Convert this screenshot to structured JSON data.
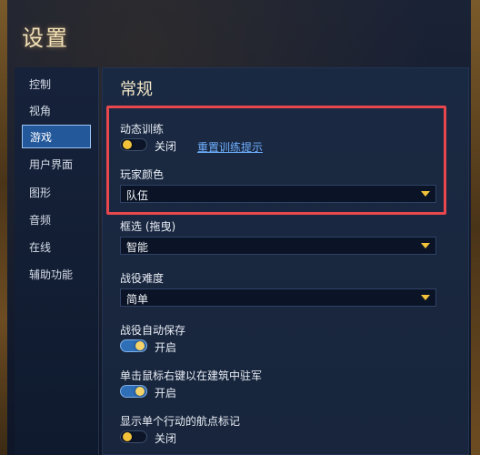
{
  "window": {
    "title": "设置"
  },
  "sidebar": {
    "items": [
      {
        "label": "控制"
      },
      {
        "label": "视角"
      },
      {
        "label": "游戏"
      },
      {
        "label": "用户界面"
      },
      {
        "label": "图形"
      },
      {
        "label": "音频"
      },
      {
        "label": "在线"
      },
      {
        "label": "辅助功能"
      }
    ],
    "active": "游戏"
  },
  "main": {
    "section_title": "常规",
    "dynamic_training": {
      "label": "动态训练",
      "state": "off",
      "state_text": "关闭",
      "reset_link": "重置训练提示"
    },
    "player_color": {
      "label": "玩家颜色",
      "value": "队伍"
    },
    "box_select": {
      "label": "框选 (拖曳)",
      "value": "智能"
    },
    "campaign_difficulty": {
      "label": "战役难度",
      "value": "简单"
    },
    "campaign_autosave": {
      "label": "战役自动保存",
      "state": "on",
      "state_text": "开启"
    },
    "right_click_garrison": {
      "label": "单击鼠标右键以在建筑中驻军",
      "state": "on",
      "state_text": "开启"
    },
    "single_action_waypoint": {
      "label": "显示单个行动的航点标记",
      "state": "off",
      "state_text": "关闭"
    }
  },
  "colors": {
    "highlight_border": "#e8474d",
    "active_tab": "#23589b",
    "link": "#6fb0ff",
    "toggle_knob": "#f2c23a"
  }
}
